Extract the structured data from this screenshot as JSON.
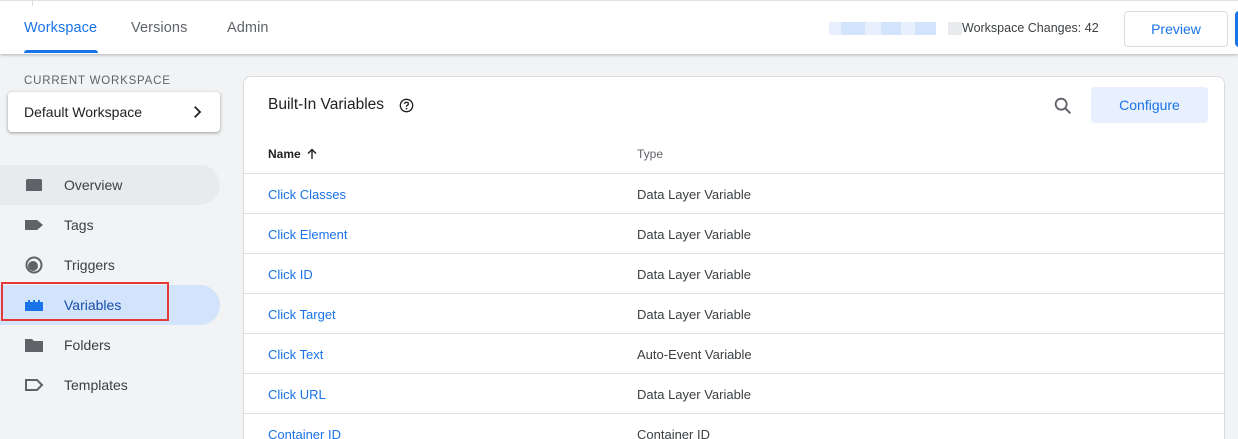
{
  "header": {
    "tabs": [
      {
        "label": "Workspace",
        "active": true
      },
      {
        "label": "Versions",
        "active": false
      },
      {
        "label": "Admin",
        "active": false
      }
    ],
    "workspace_changes": "Workspace Changes: 42",
    "preview_label": "Preview"
  },
  "sidebar": {
    "current_workspace_label": "CURRENT WORKSPACE",
    "workspace_name": "Default Workspace",
    "items": [
      {
        "label": "Overview",
        "icon": "overview-icon"
      },
      {
        "label": "Tags",
        "icon": "tag-icon"
      },
      {
        "label": "Triggers",
        "icon": "trigger-icon"
      },
      {
        "label": "Variables",
        "icon": "variables-icon",
        "active": true
      },
      {
        "label": "Folders",
        "icon": "folder-icon"
      },
      {
        "label": "Templates",
        "icon": "template-icon"
      }
    ]
  },
  "main": {
    "title": "Built-In Variables",
    "configure_label": "Configure",
    "columns": {
      "name": "Name",
      "type": "Type"
    },
    "rows": [
      {
        "name": "Click Classes",
        "type": "Data Layer Variable"
      },
      {
        "name": "Click Element",
        "type": "Data Layer Variable"
      },
      {
        "name": "Click ID",
        "type": "Data Layer Variable"
      },
      {
        "name": "Click Target",
        "type": "Data Layer Variable"
      },
      {
        "name": "Click Text",
        "type": "Auto-Event Variable"
      },
      {
        "name": "Click URL",
        "type": "Data Layer Variable"
      },
      {
        "name": "Container ID",
        "type": "Container ID"
      }
    ]
  },
  "colors": {
    "accent": "#1a73e8",
    "active_nav_bg": "#d2e3fc",
    "highlight": "#e53935"
  }
}
